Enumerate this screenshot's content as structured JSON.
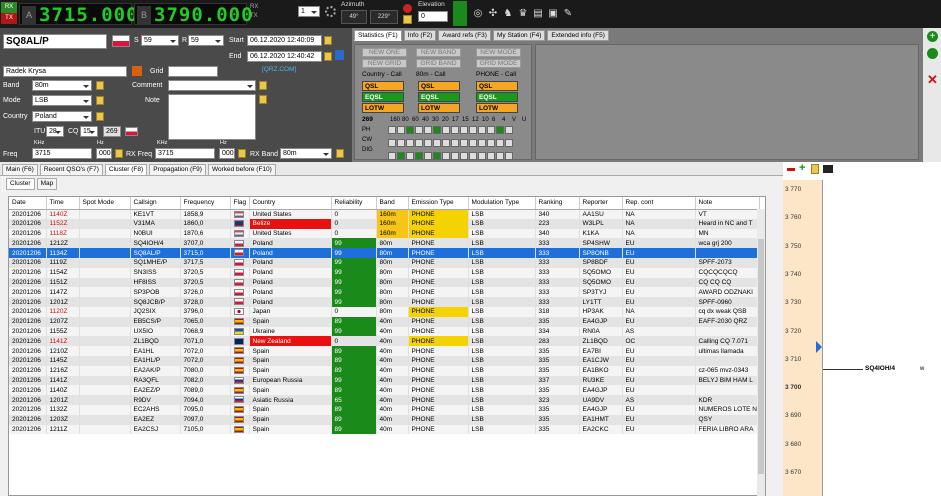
{
  "topbar": {
    "rx_label": "RX",
    "tx_label": "TX",
    "vfo_a": "3715.000",
    "vfo_b": "3790.000",
    "vfo_a_tag": "A",
    "vfo_b_tag": "B",
    "vfo_b_rx": "RX",
    "vfo_b_tx": "TX",
    "step_value": "1",
    "azimuth_label": "Azimuth",
    "az_short": "49°",
    "az_long": "229°",
    "elevation_label": "Elevation",
    "elevation_value": "0"
  },
  "left": {
    "callsign": "SQ8AL/P",
    "rst_s_label": "S",
    "rst_s": "59",
    "rst_r_label": "R",
    "rst_r": "59",
    "start_label": "Start",
    "start_value": "06.12.2020 12:40:09",
    "end_label": "End",
    "end_value": "06.12.2020 12:40:42",
    "name": "Radek Krysa",
    "grid_label": "Grid",
    "band_label": "Band",
    "band_value": "80m",
    "mode_label": "Mode",
    "mode_value": "LSB",
    "country_label": "Country",
    "country_value": "Poland",
    "itu_label": "ITU",
    "itu_value": "28",
    "cq_label": "CQ",
    "cq_value": "15",
    "dxcc_value": "269",
    "comment_label": "Comment",
    "note_label": "Note",
    "qrz_label": "[QRZ.COM]",
    "freq_label": "Freq",
    "freq_khz": "KHz",
    "freq_value": "3715",
    "freq_hz": "Hz",
    "freq_hz_value": "000",
    "rxfreq_label": "RX Freq",
    "rxfreq_khz": "KHz",
    "rxfreq_value": "3715",
    "rxfreq_hz": "Hz",
    "rxfreq_hz_value": "000",
    "band2_label": "RX Band",
    "band2_value": "80m"
  },
  "stats": {
    "tabs": [
      "Statistics (F1)",
      "Info (F2)",
      "Award refs (F3)",
      "My Station (F4)",
      "Extended info (F5)"
    ],
    "buttons": [
      "NEW ONE",
      "NEW BAND",
      "NEW MODE",
      "NEW GRID",
      "GRID BAND",
      "GRID MODE"
    ],
    "col_headers": [
      "Country - Call",
      "80m - Call",
      "PHONE - Call"
    ],
    "qsl": "QSL",
    "eqsl": "EQSL",
    "lotw": "LOTW",
    "dxcc": "269",
    "bands": [
      "160",
      "80",
      "60",
      "40",
      "30",
      "20",
      "17",
      "15",
      "12",
      "10",
      "6",
      "4",
      "V",
      "U"
    ],
    "modes": [
      "PH",
      "CW",
      "DIG"
    ]
  },
  "lowtabs": [
    "Main (F6)",
    "Recent QSO's (F7)",
    "Cluster (F8)",
    "Propagation (F9)",
    "Worked before (F10)"
  ],
  "subtabs": [
    "Cluster",
    "Map"
  ],
  "table": {
    "headers": [
      "Date",
      "Time",
      "Spot Mode",
      "Callsign",
      "Frequency",
      "Flag",
      "Country",
      "Reliability",
      "Band",
      "Emission Type",
      "Modulation Type",
      "Ranking",
      "Reporter",
      "Rep. cont",
      "Note"
    ],
    "rows": [
      [
        "20201206",
        "1140Z",
        "",
        "KE1VT",
        "1858,9",
        "",
        "United States",
        "0",
        "160m",
        "PHONE",
        "LSB",
        "340",
        "AA1SU",
        "NA",
        "VT"
      ],
      [
        "20201206",
        "1152Z",
        "",
        "V31MA",
        "1860,0",
        "",
        "Belize",
        "0",
        "160m",
        "PHONE",
        "LSB",
        "223",
        "W3LPL",
        "NA",
        "Heard in NC and T"
      ],
      [
        "20201206",
        "1118Z",
        "",
        "N0BUI",
        "1870,6",
        "",
        "United States",
        "0",
        "160m",
        "PHONE",
        "LSB",
        "340",
        "K1KA",
        "NA",
        "MN"
      ],
      [
        "20201206",
        "1212Z",
        "",
        "SQ4IOH/4",
        "3707,0",
        "",
        "Poland",
        "99",
        "80m",
        "PHONE",
        "LSB",
        "333",
        "SP4SHW",
        "EU",
        "wca grj 200"
      ],
      [
        "20201206",
        "1134Z",
        "",
        "SQ8AL/P",
        "3715,0",
        "",
        "Poland",
        "99",
        "80m",
        "PHONE",
        "LSB",
        "333",
        "SP8ONB",
        "EU",
        ""
      ],
      [
        "20201206",
        "1119Z",
        "",
        "SQ1MHE/P",
        "3717,5",
        "",
        "Poland",
        "99",
        "80m",
        "PHONE",
        "LSB",
        "333",
        "SP8BDF",
        "EU",
        "SPFF-2073"
      ],
      [
        "20201206",
        "1154Z",
        "",
        "SN3ISS",
        "3720,5",
        "",
        "Poland",
        "99",
        "80m",
        "PHONE",
        "LSB",
        "333",
        "SQ5OMO",
        "EU",
        "CQCQCQCQ"
      ],
      [
        "20201206",
        "1151Z",
        "",
        "HF8ISS",
        "3720,5",
        "",
        "Poland",
        "99",
        "80m",
        "PHONE",
        "LSB",
        "333",
        "SQ5OMO",
        "EU",
        "CQ CQ CQ"
      ],
      [
        "20201206",
        "1147Z",
        "",
        "SP3POB",
        "3726,0",
        "",
        "Poland",
        "99",
        "80m",
        "PHONE",
        "LSB",
        "333",
        "SP3TYJ",
        "EU",
        "AWARD ODZNAKI"
      ],
      [
        "20201206",
        "1201Z",
        "",
        "SQ8JCB/P",
        "3728,0",
        "",
        "Poland",
        "99",
        "80m",
        "PHONE",
        "LSB",
        "333",
        "LY1TT",
        "EU",
        "SPFF-0960"
      ],
      [
        "20201206",
        "1120Z",
        "",
        "JQ2SIX",
        "3796,0",
        "",
        "Japan",
        "0",
        "80m",
        "PHONE",
        "LSB",
        "318",
        "HP3AK",
        "NA",
        "cq dx weak QSB"
      ],
      [
        "20201206",
        "1207Z",
        "",
        "EB5CS/P",
        "7065,0",
        "",
        "Spain",
        "89",
        "40m",
        "PHONE",
        "LSB",
        "335",
        "EA4GJP",
        "EU",
        "EAFF-2030 QRZ"
      ],
      [
        "20201206",
        "1155Z",
        "",
        "UX5IO",
        "7068,9",
        "",
        "Ukraine",
        "99",
        "40m",
        "PHONE",
        "LSB",
        "334",
        "RN0A",
        "AS",
        ""
      ],
      [
        "20201206",
        "1141Z",
        "",
        "ZL1BQD",
        "7071,0",
        "",
        "New Zealand",
        "0",
        "40m",
        "PHONE",
        "LSB",
        "283",
        "ZL1BQD",
        "OC",
        "Calling CQ 7.071"
      ],
      [
        "20201206",
        "1210Z",
        "",
        "EA1HL",
        "7072,0",
        "",
        "Spain",
        "89",
        "40m",
        "PHONE",
        "LSB",
        "335",
        "EA7BI",
        "EU",
        "ultimas llamada"
      ],
      [
        "20201206",
        "1145Z",
        "",
        "EA1HL/P",
        "7072,0",
        "",
        "Spain",
        "89",
        "40m",
        "PHONE",
        "LSB",
        "335",
        "EA1CJW",
        "EU",
        ""
      ],
      [
        "20201206",
        "1216Z",
        "",
        "EA2AK/P",
        "7080,0",
        "",
        "Spain",
        "89",
        "40m",
        "PHONE",
        "LSB",
        "335",
        "EA1BKO",
        "EU",
        "cz-065 mvz-0343"
      ],
      [
        "20201206",
        "1141Z",
        "",
        "RA3QFL",
        "7082,0",
        "",
        "European Russia",
        "99",
        "40m",
        "PHONE",
        "LSB",
        "337",
        "RU3KE",
        "EU",
        "BELYJ BIM HAM L"
      ],
      [
        "20201206",
        "1140Z",
        "",
        "EA2EZ/P",
        "7089,0",
        "",
        "Spain",
        "89",
        "40m",
        "PHONE",
        "LSB",
        "335",
        "EA4GJP",
        "EU",
        ""
      ],
      [
        "20201206",
        "1201Z",
        "",
        "R9DV",
        "7094,0",
        "",
        "Asiatic Russia",
        "65",
        "40m",
        "PHONE",
        "LSB",
        "323",
        "UA9DV",
        "AS",
        "KDR"
      ],
      [
        "20201206",
        "1132Z",
        "",
        "EC2AHS",
        "7095,0",
        "",
        "Spain",
        "89",
        "40m",
        "PHONE",
        "LSB",
        "335",
        "EA4GJP",
        "EU",
        "NUMEROS LOTE N"
      ],
      [
        "20201206",
        "1203Z",
        "",
        "EA2EZ",
        "7097,0",
        "",
        "Spain",
        "89",
        "40m",
        "PHONE",
        "LSB",
        "335",
        "EA1HMT",
        "EU",
        "QSY"
      ],
      [
        "20201206",
        "1211Z",
        "",
        "EA2CSJ",
        "7105,0",
        "",
        "Spain",
        "89",
        "40m",
        "PHONE",
        "LSB",
        "335",
        "EA2CKC",
        "EU",
        "FERIA LIBRO ARA"
      ]
    ]
  },
  "bandmap": {
    "ticks": [
      "3 770",
      "3 760",
      "3 750",
      "3 740",
      "3 730",
      "3 720",
      "3 710",
      "3 700",
      "3 690",
      "3 680",
      "3 670"
    ],
    "spot_call": "SQ4IOH/4",
    "spot_suffix": "w"
  },
  "colors": {
    "accent": "#1e6fd9",
    "vfo": "#22cc22",
    "reliability": "#1a8a1a",
    "band160": "#f5c518"
  }
}
